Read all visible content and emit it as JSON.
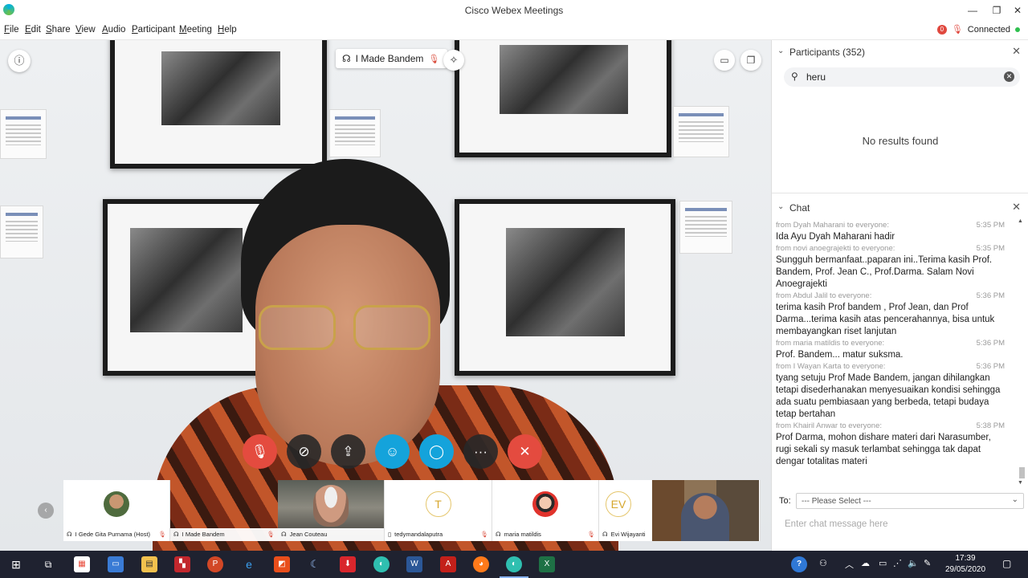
{
  "window": {
    "title": "Cisco Webex Meetings",
    "controls": [
      "—",
      "❐",
      "✕"
    ]
  },
  "menu": [
    "File",
    "Edit",
    "Share",
    "View",
    "Audio",
    "Participant",
    "Meeting",
    "Help"
  ],
  "status": {
    "badge": "0",
    "text": "Connected"
  },
  "video": {
    "active_speaker": "I Made Bandem",
    "controls": [
      "mute-button",
      "video-button",
      "share-button",
      "participants-button",
      "chat-button",
      "more-button",
      "leave-button"
    ]
  },
  "thumbnails": [
    {
      "name": "I Gede Gita Purnama (Host)",
      "kind": "photo"
    },
    {
      "name": "I Made Bandem",
      "kind": "self"
    },
    {
      "name": "Jean Couteau",
      "kind": "video"
    },
    {
      "name": "tedymandalaputra",
      "kind": "letter",
      "letter": "T"
    },
    {
      "name": "maria matildis",
      "kind": "photo"
    },
    {
      "name": "Evi Wijayanti",
      "kind": "letter",
      "letter": "EV"
    }
  ],
  "participants": {
    "header": "Participants (352)",
    "search_value": "heru",
    "empty_text": "No results found"
  },
  "chat": {
    "header": "Chat",
    "messages": [
      {
        "from": "from Dyah Maharani to everyone:",
        "time": "5:35 PM",
        "text": "Ida Ayu Dyah Maharani hadir"
      },
      {
        "from": "from novi anoegrajekti to everyone:",
        "time": "5:35 PM",
        "text": "Sungguh bermanfaat..paparan ini..Terima kasih Prof. Bandem, Prof. Jean C., Prof.Darma. Salam Novi Anoegrajekti"
      },
      {
        "from": "from Abdul Jalil to everyone:",
        "time": "5:36 PM",
        "text": "terima kasih Prof bandem , Prof Jean, dan Prof Darma...terima kasih atas pencerahannya, bisa untuk membayangkan riset lanjutan"
      },
      {
        "from": "from maria matildis to everyone:",
        "time": "5:36 PM",
        "text": "Prof. Bandem... matur suksma."
      },
      {
        "from": "from I Wayan Karta to everyone:",
        "time": "5:36 PM",
        "text": "tyang setuju Prof Made Bandem, jangan dihilangkan tetapi disederhanakan menyesuaikan kondisi sehingga ada suatu pembiasaan yang berbeda, tetapi budaya tetap bertahan"
      },
      {
        "from": "from Khairil Anwar to everyone:",
        "time": "5:38 PM",
        "text": "Prof Darma, mohon dishare materi dari Narasumber, rugi sekali sy masuk terlambat sehingga tak dapat dengar totalitas materi"
      }
    ],
    "to_label": "To:",
    "to_value": "--- Please Select ---",
    "input_placeholder": "Enter chat message here"
  },
  "taskbar": {
    "time": "17:39",
    "date": "29/05/2020"
  }
}
